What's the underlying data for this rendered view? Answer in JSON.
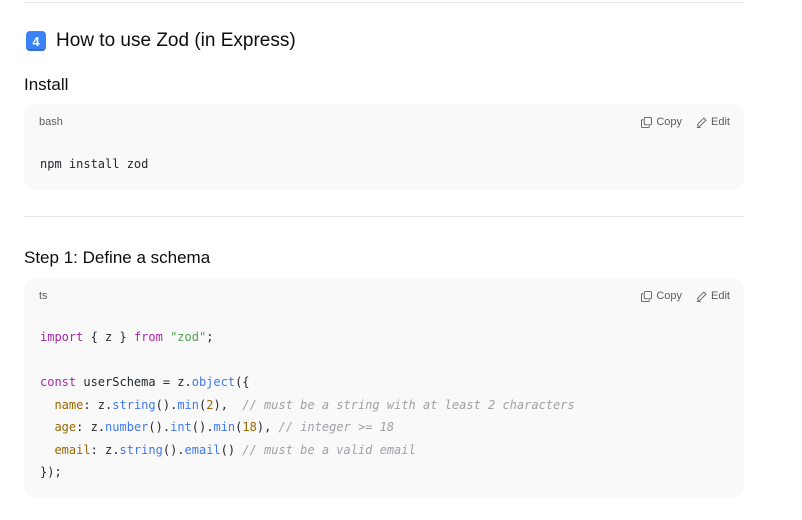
{
  "section": {
    "emoji_badge": "4",
    "title": "How to use Zod (in Express)"
  },
  "install": {
    "heading": "Install",
    "block": {
      "language": "bash",
      "copy_label": "Copy",
      "edit_label": "Edit",
      "code": "npm install zod"
    }
  },
  "step1": {
    "heading": "Step 1: Define a schema",
    "block": {
      "language": "ts",
      "copy_label": "Copy",
      "edit_label": "Edit",
      "lines": [
        [
          {
            "t": "kw",
            "v": "import"
          },
          {
            "t": "p",
            "v": " { z } "
          },
          {
            "t": "kw",
            "v": "from"
          },
          {
            "t": "p",
            "v": " "
          },
          {
            "t": "str",
            "v": "\"zod\""
          },
          {
            "t": "p",
            "v": ";"
          }
        ],
        [],
        [
          {
            "t": "kw",
            "v": "const"
          },
          {
            "t": "p",
            "v": " userSchema = z."
          },
          {
            "t": "fn",
            "v": "object"
          },
          {
            "t": "p",
            "v": "({"
          }
        ],
        [
          {
            "t": "p",
            "v": "  "
          },
          {
            "t": "prop",
            "v": "name"
          },
          {
            "t": "p",
            "v": ": z."
          },
          {
            "t": "fn",
            "v": "string"
          },
          {
            "t": "p",
            "v": "()."
          },
          {
            "t": "fn",
            "v": "min"
          },
          {
            "t": "p",
            "v": "("
          },
          {
            "t": "num",
            "v": "2"
          },
          {
            "t": "p",
            "v": "),  "
          },
          {
            "t": "cm",
            "v": "// must be a string with at least 2 characters"
          }
        ],
        [
          {
            "t": "p",
            "v": "  "
          },
          {
            "t": "prop",
            "v": "age"
          },
          {
            "t": "p",
            "v": ": z."
          },
          {
            "t": "fn",
            "v": "number"
          },
          {
            "t": "p",
            "v": "()."
          },
          {
            "t": "fn",
            "v": "int"
          },
          {
            "t": "p",
            "v": "()."
          },
          {
            "t": "fn",
            "v": "min"
          },
          {
            "t": "p",
            "v": "("
          },
          {
            "t": "num",
            "v": "18"
          },
          {
            "t": "p",
            "v": "), "
          },
          {
            "t": "cm",
            "v": "// integer >= 18"
          }
        ],
        [
          {
            "t": "p",
            "v": "  "
          },
          {
            "t": "prop",
            "v": "email"
          },
          {
            "t": "p",
            "v": ": z."
          },
          {
            "t": "fn",
            "v": "string"
          },
          {
            "t": "p",
            "v": "()."
          },
          {
            "t": "fn",
            "v": "email"
          },
          {
            "t": "p",
            "v": "() "
          },
          {
            "t": "cm",
            "v": "// must be a valid email"
          }
        ],
        [
          {
            "t": "p",
            "v": "});"
          }
        ]
      ]
    }
  },
  "icons": {
    "copy": "copy-icon",
    "edit": "edit-icon",
    "emoji": "keycap-4-emoji"
  },
  "colors": {
    "code_bg": "#f9f9f9",
    "keyword": "#a626a4",
    "string": "#50a14f",
    "function": "#4078f2",
    "number": "#986801",
    "comment": "#a0a1a7"
  }
}
